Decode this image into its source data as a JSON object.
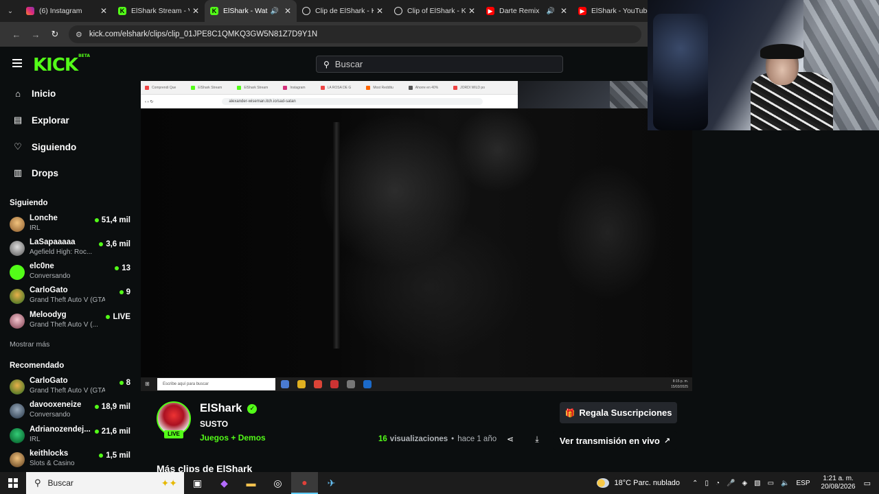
{
  "browser": {
    "tabs": [
      {
        "label": "(6) Instagram",
        "favicon": "instagram-icon"
      },
      {
        "label": "ElShark Stream - V",
        "favicon": "kick-icon"
      },
      {
        "label": "ElShark - Wat",
        "favicon": "kick-icon",
        "active": true,
        "audio": true
      },
      {
        "label": "Clip de ElShark - K",
        "favicon": "clip-icon"
      },
      {
        "label": "Clip of ElShark - K",
        "favicon": "clip-icon"
      },
      {
        "label": "Darte Remix",
        "favicon": "youtube-icon",
        "audio": true
      },
      {
        "label": "ElShark - YouTube",
        "favicon": "youtube-icon"
      }
    ],
    "url": "kick.com/elshark/clips/clip_01JPE8C1QMKQ3GW5N81Z7D9Y1N"
  },
  "site": {
    "logo": "KICK",
    "logo_badge": "BETA",
    "search_placeholder": "Buscar",
    "accent": "#53fc18"
  },
  "sidebar": {
    "nav": [
      {
        "label": "Inicio",
        "icon": "home-icon"
      },
      {
        "label": "Explorar",
        "icon": "compass-icon"
      },
      {
        "label": "Siguiendo",
        "icon": "heart-icon"
      },
      {
        "label": "Drops",
        "icon": "drops-icon"
      }
    ],
    "following_title": "Siguiendo",
    "following": [
      {
        "name": "Lonche",
        "category": "IRL",
        "viewers": "51,4 mil"
      },
      {
        "name": "LaSapaaaaa",
        "category": "Agefield High: Roc...",
        "viewers": "3,6 mil"
      },
      {
        "name": "elc0ne",
        "category": "Conversando",
        "viewers": "13"
      },
      {
        "name": "CarloGato",
        "category": "Grand Theft Auto V (GTA)",
        "viewers": "9"
      },
      {
        "name": "Meloodyg",
        "category": "Grand Theft Auto V (...",
        "viewers": "LIVE"
      }
    ],
    "show_more": "Mostrar más",
    "recommended_title": "Recomendado",
    "recommended": [
      {
        "name": "CarloGato",
        "category": "Grand Theft Auto V (GTA)",
        "viewers": "8"
      },
      {
        "name": "davooxeneize",
        "category": "Conversando",
        "viewers": "18,9 mil"
      },
      {
        "name": "Adrianozendej...",
        "category": "IRL",
        "viewers": "21,6 mil"
      },
      {
        "name": "keithlocks",
        "category": "Slots & Casino",
        "viewers": "1,5 mil"
      }
    ]
  },
  "player": {
    "inner_tabs": [
      "Comprendi Que",
      "ElShark Stream",
      "ElShark Stream",
      "Instagram",
      "LA ROSA DE G",
      "Most Redditu",
      "Ahorre en 40%",
      "JORDI WILD po"
    ],
    "inner_url": "alexander-wiseman.itch.io/sad-satan",
    "inner_search": "Escribe aquí para buscar",
    "inner_time": "8:15 p. m.",
    "inner_date": "15/03/2025"
  },
  "clip": {
    "streamer": "ElShark",
    "live_badge": "LIVE",
    "title": "SUSTO",
    "category": "Juegos + Demos",
    "gift_label": "Regala Suscripciones",
    "views_count": "16",
    "views_label": "visualizaciones",
    "separator": "•",
    "age": "hace 1 año",
    "watch_live_label": "Ver transmisión en vivo",
    "more_clips_title": "Más clips de ElShark"
  },
  "taskbar": {
    "search_placeholder": "Buscar",
    "weather": "18°C  Parc. nublado",
    "language": "ESP",
    "time": "1:21 a. m.",
    "date": "20/08/2026"
  }
}
